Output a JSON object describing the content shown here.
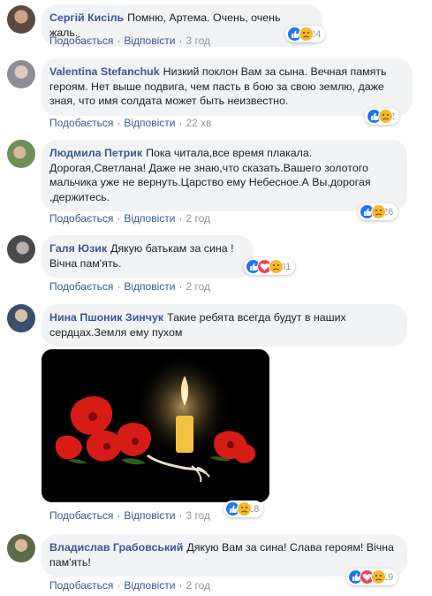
{
  "comments": [
    {
      "author": "Сергій Кисіль",
      "text": "Помню, Артема. Очень, очень жаль.",
      "like": "Подобається",
      "reply": "Відповісти",
      "time": "3 год",
      "count": "24"
    },
    {
      "author": "Valentina Stefanchuk",
      "text": "Низкий поклон Вам за сына. Вечная память героям. Нет выше подвига, чем пасть в бою за свою землю, даже зная, что имя солдата может быть неизвестно.",
      "like": "Подобається",
      "reply": "Відповісти",
      "time": "22 хв",
      "count": "2"
    },
    {
      "author": "Людмила Петрик",
      "text": "Пока читала,все время плакала. Дорогая,Светлана! Даже не знаю,что сказать.Вашего золотого мальчика уже не вернуть.Царство ему Небесное.А Вы,дорогая ,держитесь.",
      "like": "Подобається",
      "reply": "Відповісти",
      "time": "2 год",
      "count": "26"
    },
    {
      "author": "Галя Юзик",
      "text": "Дякую батькам за сина ! Вічна пам'ять.",
      "like": "Подобається",
      "reply": "Відповісти",
      "time": "2 год",
      "count": "31"
    },
    {
      "author": "Нина Пшоник Зинчук",
      "text": "Такие ребята всегда будут в наших сердцах.Земля ему пухом",
      "like": "Подобається",
      "reply": "Відповісти",
      "time": "3 год",
      "count": "18"
    },
    {
      "author": "Владислав Грабовський",
      "text": "Дякую Вам за сина! Слава героям! Вічна пам'ять!",
      "like": "Подобається",
      "reply": "Відповісти",
      "time": "2 год",
      "count": "19"
    }
  ],
  "colors": {
    "link": "#385898",
    "bubble": "#f2f3f5",
    "like": "#1877f2",
    "love": "#f33e58",
    "sad": "#f7b928"
  }
}
